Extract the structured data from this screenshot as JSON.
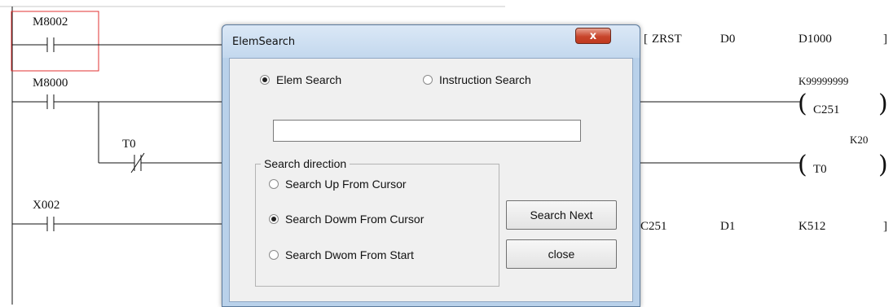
{
  "ladder": {
    "top_contact": "M8002",
    "rung1": {
      "instr": "ZRST",
      "op1": "D0",
      "op2": "D1000",
      "bracket": "]"
    },
    "rung2": {
      "contact": "M8000",
      "const": "K99999999",
      "coil": "C251",
      "paren": ")"
    },
    "rung3": {
      "contact": "T0",
      "const": "K20",
      "coil": "T0",
      "paren": ")"
    },
    "rung4": {
      "contact": "X002",
      "op0": "C251",
      "op1": "D1",
      "op2": "K512",
      "bracket": "]"
    },
    "open_paren": "("
  },
  "dialog": {
    "title": "ElemSearch",
    "close_glyph": "x",
    "mode_options": [
      {
        "label": "Elem Search",
        "selected": true
      },
      {
        "label": "Instruction Search",
        "selected": false
      }
    ],
    "search_value": "",
    "group_label": "Search direction",
    "direction_options": [
      {
        "label": "Search Up From Cursor",
        "selected": false
      },
      {
        "label": "Search Dowm From Cursor",
        "selected": true
      },
      {
        "label": "Search Dwom From Start",
        "selected": false
      }
    ],
    "search_next_label": "Search  Next",
    "close_label": "close"
  }
}
